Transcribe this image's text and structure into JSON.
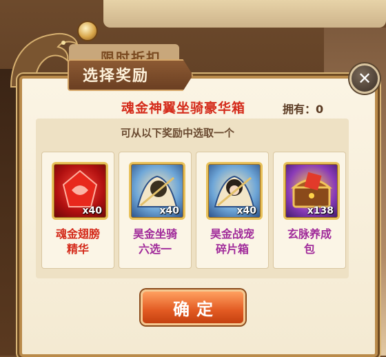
{
  "background": {
    "top_text": "...",
    "tab_text": "限时折扣"
  },
  "dialog": {
    "title": "选择奖励",
    "chest_name": "魂金神翼坐骑豪华箱",
    "own_label": "拥有：0",
    "instruction": "可从以下奖励中选取一个",
    "items": [
      {
        "name": "魂金翅膀\n精华",
        "qty": "x40",
        "icon": "red-gem-icon",
        "name_color": "#d42a1a"
      },
      {
        "name": "昊金坐骑\n六选一",
        "qty": "x40",
        "icon": "mount-selector-icon",
        "name_color": "#a02a9a"
      },
      {
        "name": "昊金战宠\n碎片箱",
        "qty": "x40",
        "icon": "pet-shard-icon",
        "name_color": "#a02a9a"
      },
      {
        "name": "玄脉养成\n包",
        "qty": "x138",
        "icon": "treasure-chest-icon",
        "name_color": "#a02a9a"
      }
    ],
    "confirm_label": "确定",
    "close_glyph": "✕"
  },
  "colors": {
    "accent_red": "#d42a1a",
    "button_orange": "#e25a22",
    "frame_gold": "#e8c15a"
  }
}
